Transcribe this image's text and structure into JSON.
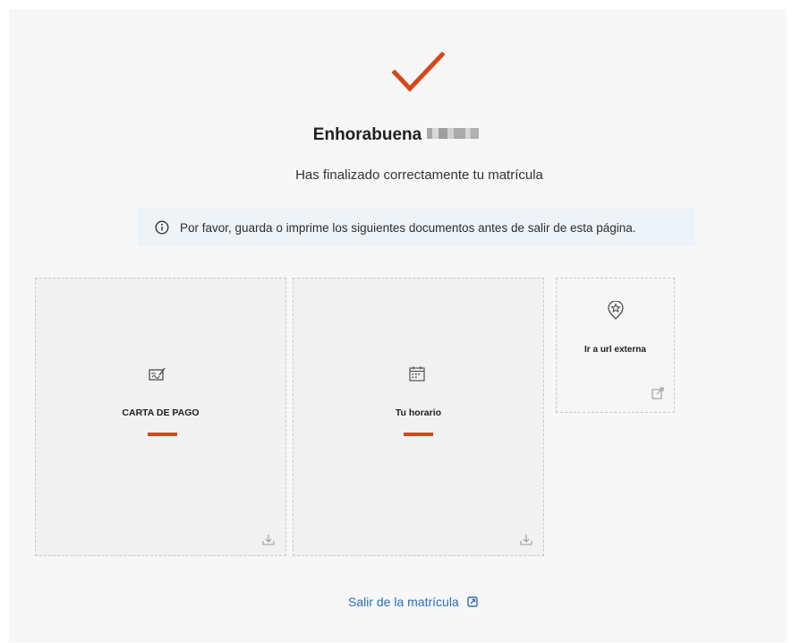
{
  "success": {
    "icon": "checkmark-icon",
    "title": "Enhorabuena",
    "subtitle": "Has finalizado correctamente tu matrícula"
  },
  "notice": {
    "icon": "info-icon",
    "text": "Por favor, guarda o imprime los siguientes documentos antes de salir de esta página."
  },
  "documents": [
    {
      "label": "CARTA DE PAGO",
      "icon": "payment-card-icon",
      "action_icon": "download-icon"
    },
    {
      "label": "Tu horario",
      "icon": "calendar-icon",
      "action_icon": "download-icon"
    },
    {
      "label": "Ir a url externa",
      "icon": "location-star-icon",
      "action_icon": "external-link-icon"
    }
  ],
  "footer": {
    "exit_label": "Salir de la matrícula",
    "exit_icon": "external-link-icon"
  },
  "colors": {
    "accent": "#d6471a",
    "link": "#2a6fb0",
    "panel_background": "#f7f7f7",
    "notice_background": "#eef3f8"
  }
}
